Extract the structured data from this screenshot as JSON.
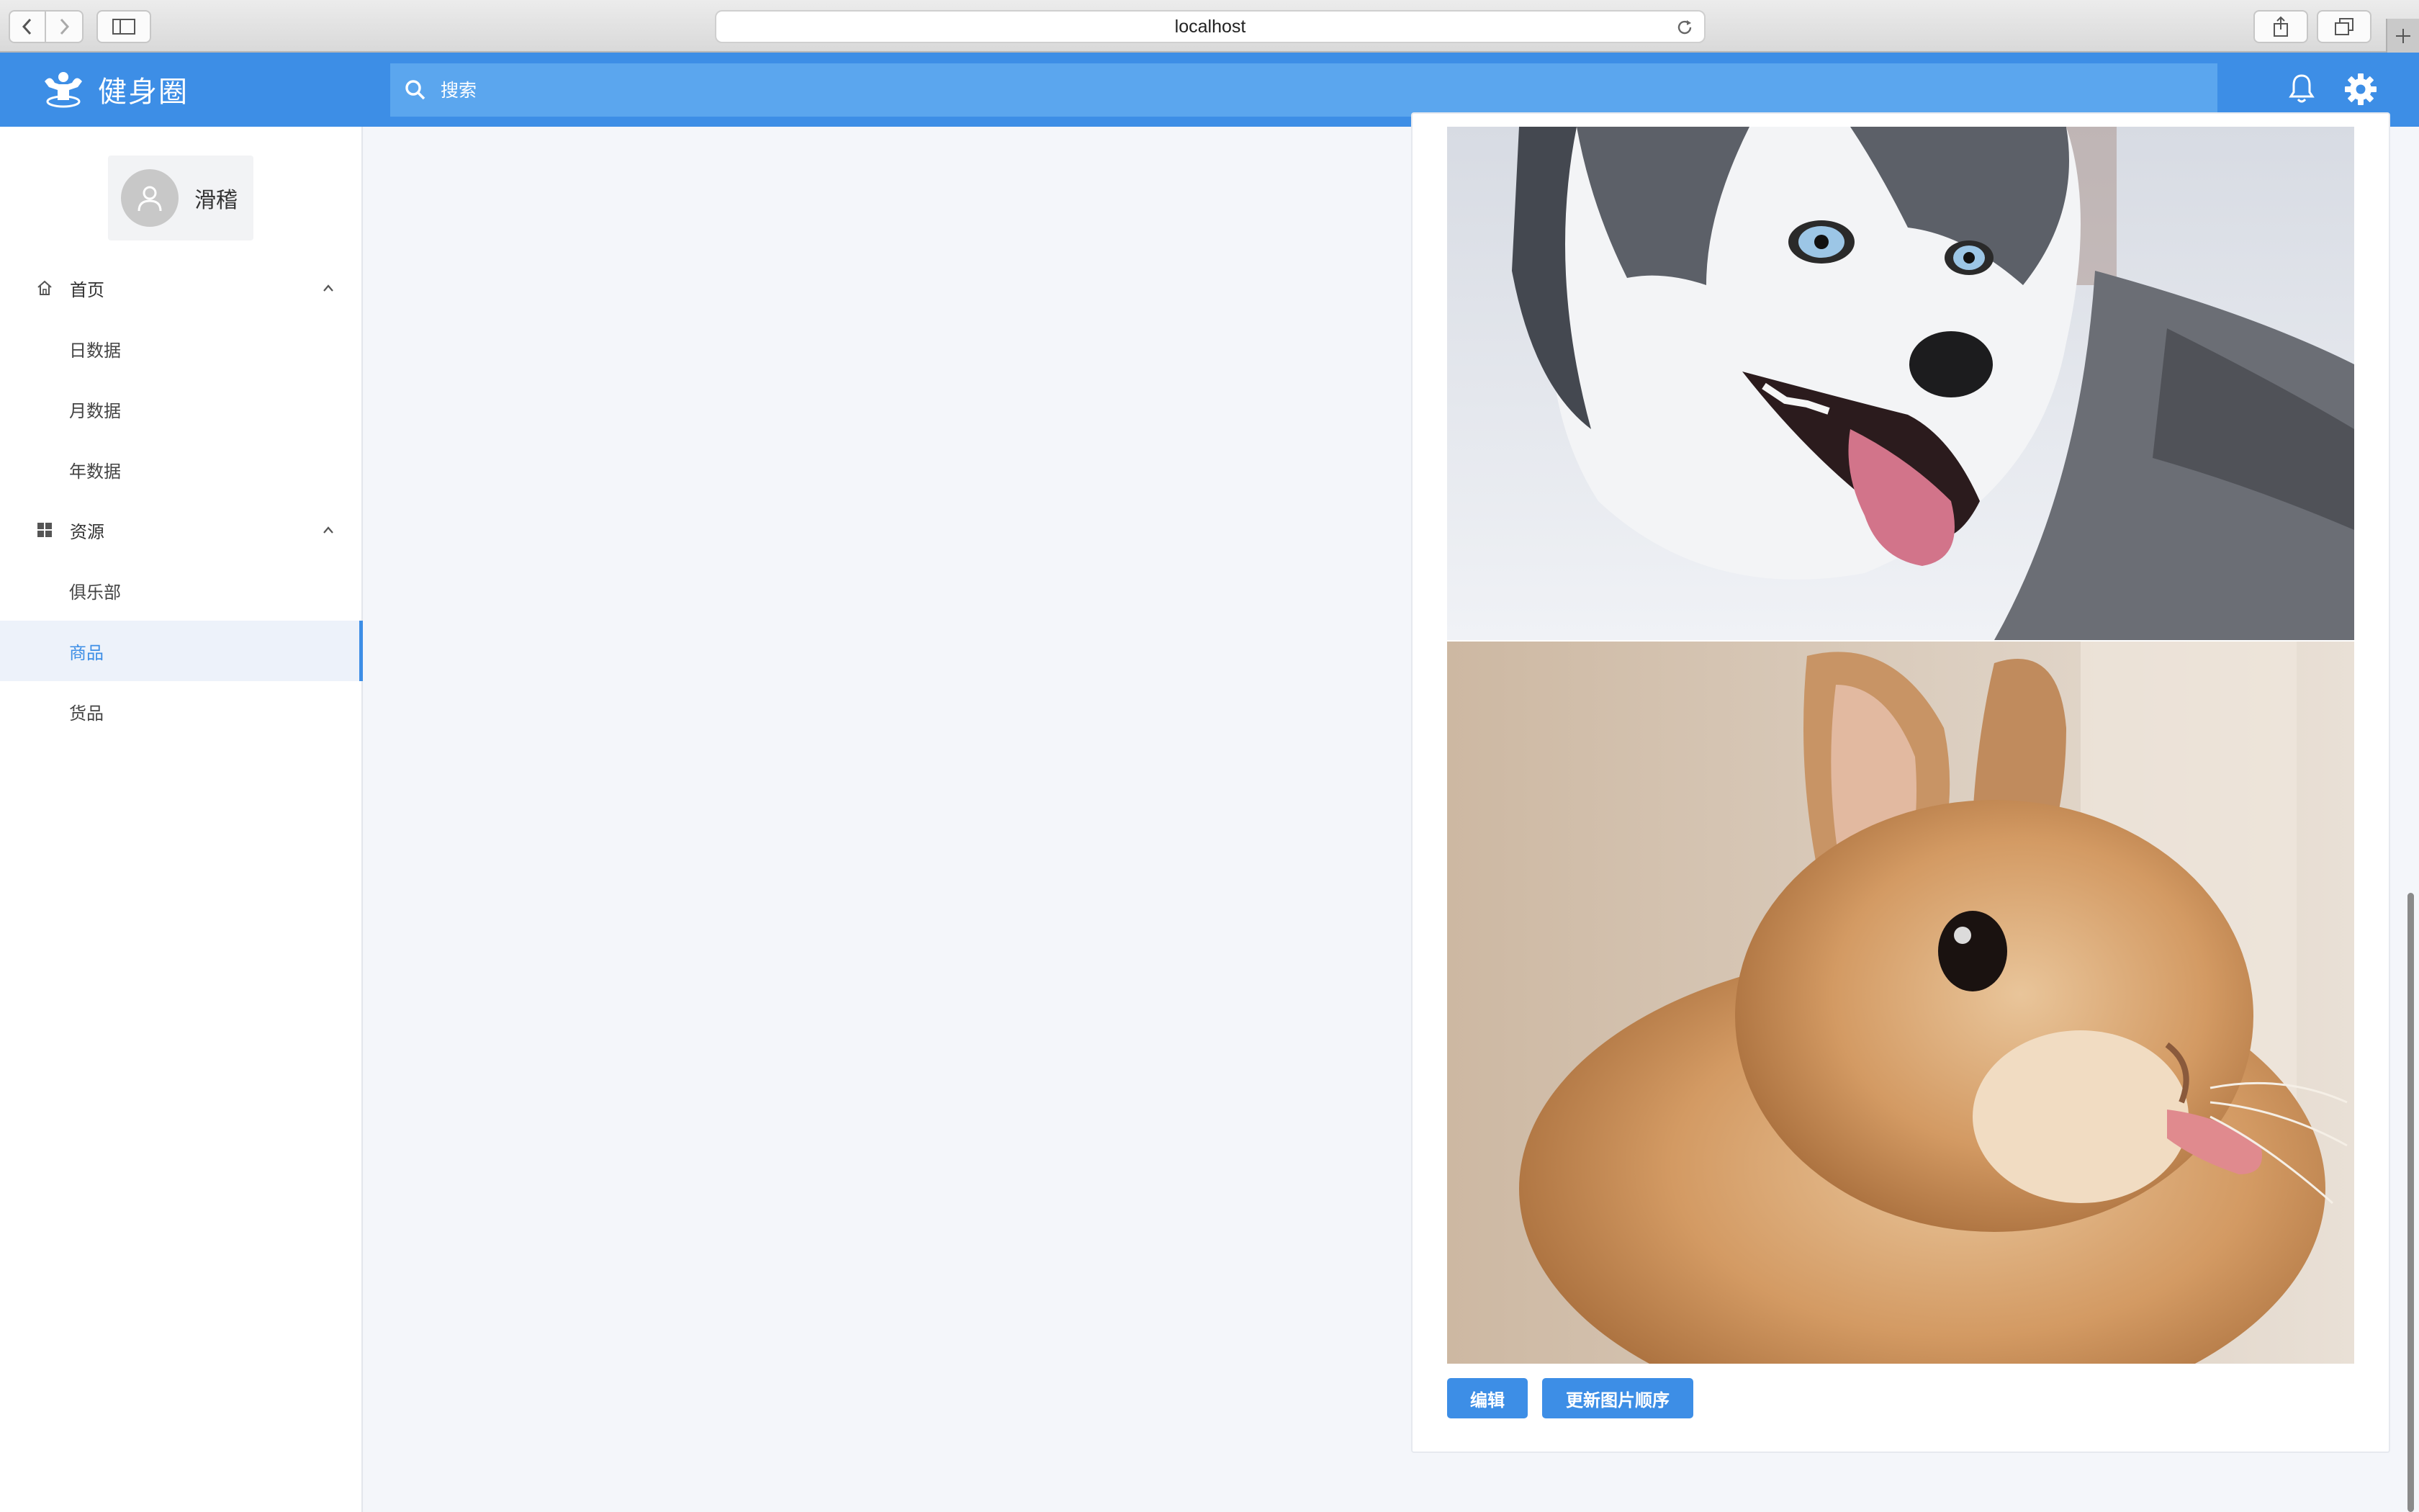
{
  "browser": {
    "url": "localhost"
  },
  "header": {
    "app_title": "健身圈",
    "search_placeholder": "搜索",
    "logo_icon": "fitness-logo-icon",
    "bell_icon": "bell-icon",
    "settings_icon": "gear-icon"
  },
  "user": {
    "name": "滑稽"
  },
  "sidebar": {
    "groups": [
      {
        "label": "首页",
        "icon": "home-icon",
        "expanded": true,
        "items": [
          {
            "label": "日数据"
          },
          {
            "label": "月数据"
          },
          {
            "label": "年数据"
          }
        ]
      },
      {
        "label": "资源",
        "icon": "grid-icon",
        "expanded": true,
        "items": [
          {
            "label": "俱乐部"
          },
          {
            "label": "商品",
            "active": true
          },
          {
            "label": "货品"
          }
        ]
      }
    ]
  },
  "content": {
    "images": [
      "husky-photo",
      "rabbit-photo"
    ],
    "buttons": {
      "edit": "编辑",
      "reorder": "更新图片顺序"
    }
  },
  "colors": {
    "accent": "#3d8ee6",
    "search_bg": "#5ba6ee",
    "page_bg": "#f4f6fa"
  }
}
